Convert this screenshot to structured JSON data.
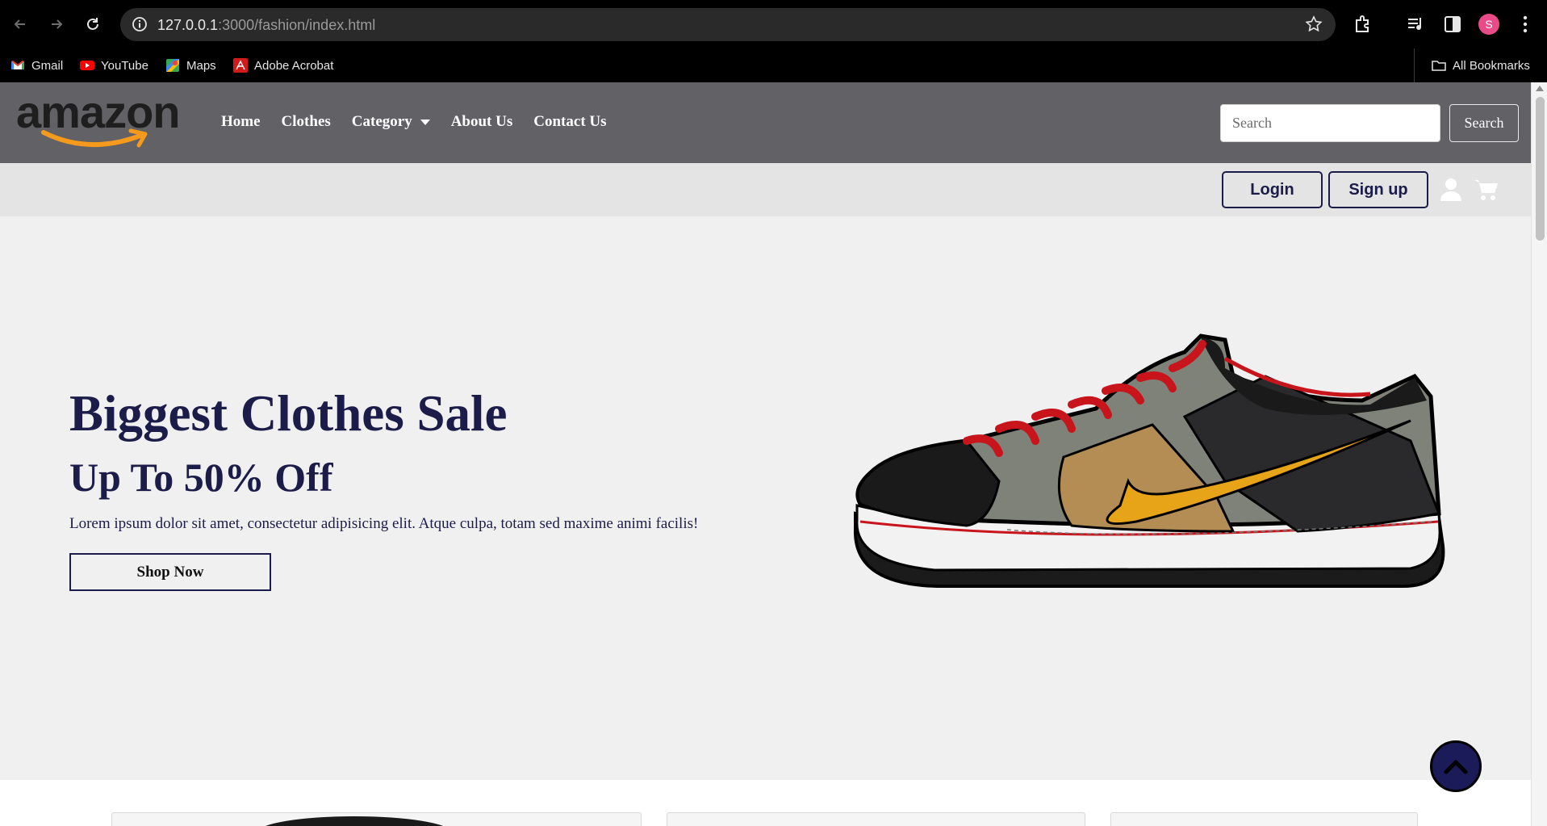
{
  "browser": {
    "url_host": "127.0.0.1",
    "url_rest": ":3000/fashion/index.html",
    "profile_initial": "S",
    "bookmarks": [
      {
        "label": "Gmail",
        "icon": "gmail-icon"
      },
      {
        "label": "YouTube",
        "icon": "youtube-icon"
      },
      {
        "label": "Maps",
        "icon": "maps-icon"
      },
      {
        "label": "Adobe Acrobat",
        "icon": "acrobat-icon"
      }
    ],
    "all_bookmarks": "All Bookmarks"
  },
  "site": {
    "logo_text": "amazon",
    "nav": {
      "home": "Home",
      "clothes": "Clothes",
      "category": "Category",
      "about": "About Us",
      "contact": "Contact Us"
    },
    "search": {
      "placeholder": "Search",
      "button": "Search"
    },
    "auth": {
      "login": "Login",
      "signup": "Sign up"
    }
  },
  "hero": {
    "title": "Biggest Clothes Sale",
    "subtitle": "Up To 50% Off",
    "description": "Lorem ipsum dolor sit amet, consectetur adipisicing elit. Atque culpa, totam sed maxime animi facilis!",
    "cta": "Shop Now"
  },
  "colors": {
    "nav_bg": "#616166",
    "accent_navy": "#1c1c4a",
    "hero_bg": "#f0f0f0",
    "logo_smile": "#f59a1c"
  }
}
